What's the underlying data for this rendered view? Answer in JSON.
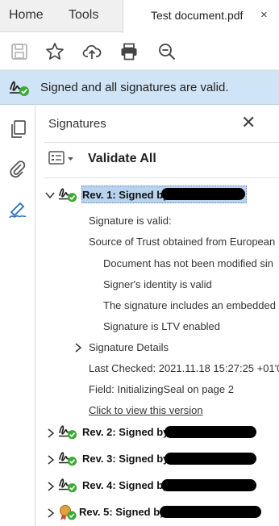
{
  "tabs": {
    "home": "Home",
    "tools": "Tools",
    "document": {
      "title": "Test document.pdf",
      "close": "×"
    }
  },
  "toolbar": {
    "icons": [
      "save-icon",
      "bookmark-star-icon",
      "upload-cloud-icon",
      "print-icon",
      "zoom-out-icon"
    ]
  },
  "banner": {
    "text": "Signed and all signatures are valid.",
    "color": "#cfe4f6"
  },
  "rail": {
    "icons": [
      "pages-icon",
      "attachments-icon",
      "signatures-icon"
    ]
  },
  "panel": {
    "title": "Signatures",
    "close": "✕",
    "validate_all": "Validate All",
    "revisions": [
      {
        "label": "Rev. 1: Signed by",
        "expanded": true,
        "selected": true,
        "details": {
          "signature_valid": "Signature is valid:",
          "source_of_trust": "Source of Trust obtained from European",
          "not_modified": "Document has not been modified sin",
          "signer_identity": "Signer's identity is valid",
          "embedded": "The signature includes an embedded",
          "ltv": "Signature is LTV enabled",
          "signature_details": "Signature Details",
          "last_checked": "Last Checked: 2021.11.18 15:27:25 +01'0(",
          "field": "Field: InitializingSeal on page 2",
          "view_version": "Click to view this version"
        }
      },
      {
        "label": "Rev. 2: Signed by",
        "expanded": false
      },
      {
        "label": "Rev. 3: Signed by",
        "expanded": false
      },
      {
        "label": "Rev. 4: Signed by",
        "expanded": false
      },
      {
        "label": "Rev. 5: Signed by",
        "expanded": false
      }
    ]
  },
  "colors": {
    "selection": "#b8d3ee",
    "valid_check": "#3aa935"
  }
}
